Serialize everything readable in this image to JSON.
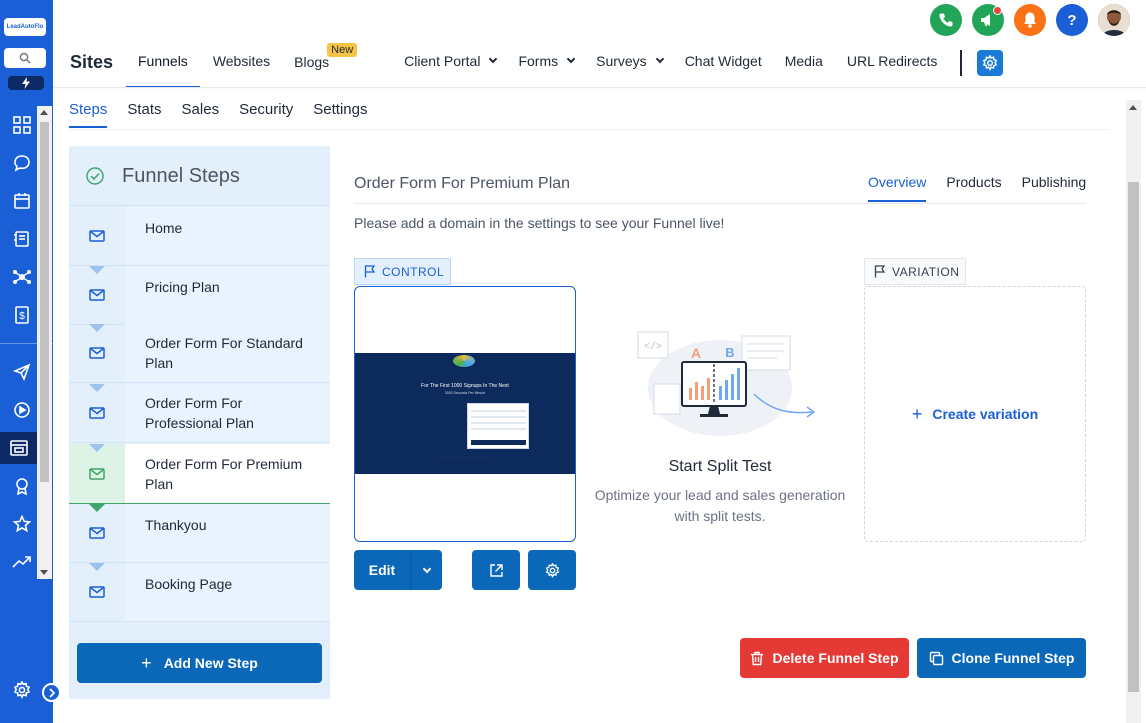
{
  "brand": {
    "logo_text": "LeadAutoFlo"
  },
  "colors": {
    "primary": "#1a5fd6",
    "button": "#0b67b8",
    "danger": "#e53935",
    "success": "#3fa56a",
    "panel": "#e3f0fc"
  },
  "rail": {
    "icons": [
      "dashboard-icon",
      "chat-icon",
      "calendar-icon",
      "contacts-icon",
      "network-icon",
      "payments-icon",
      "send-icon",
      "play-icon",
      "sites-icon",
      "award-icon",
      "star-icon",
      "trending-icon",
      "settings-icon"
    ]
  },
  "top_icons": [
    "phone-icon",
    "megaphone-icon",
    "bell-icon",
    "help-icon",
    "avatar"
  ],
  "header": {
    "title": "Sites",
    "nav": [
      {
        "label": "Funnels",
        "active": true
      },
      {
        "label": "Websites"
      },
      {
        "label": "Blogs",
        "badge": "New"
      },
      {
        "label": "Client Portal",
        "dropdown": true
      },
      {
        "label": "Forms",
        "dropdown": true
      },
      {
        "label": "Surveys",
        "dropdown": true
      },
      {
        "label": "Chat Widget"
      },
      {
        "label": "Media"
      },
      {
        "label": "URL Redirects"
      }
    ]
  },
  "subtabs": [
    {
      "label": "Steps",
      "active": true
    },
    {
      "label": "Stats"
    },
    {
      "label": "Sales"
    },
    {
      "label": "Security"
    },
    {
      "label": "Settings"
    }
  ],
  "steps_panel": {
    "title": "Funnel Steps",
    "steps": [
      {
        "label": "Home"
      },
      {
        "label": "Pricing Plan"
      },
      {
        "label": "Order Form For Standard Plan"
      },
      {
        "label": "Order Form For Professional Plan"
      },
      {
        "label": "Order Form For Premium Plan",
        "active": true
      },
      {
        "label": "Thankyou"
      },
      {
        "label": "Booking Page"
      }
    ],
    "add_button": "Add New Step"
  },
  "content": {
    "title": "Order Form For Premium Plan",
    "tabs": [
      {
        "label": "Overview",
        "active": true
      },
      {
        "label": "Products"
      },
      {
        "label": "Publishing"
      }
    ],
    "domain_message": "Please add a domain in the settings to see your Funnel live!",
    "control_tag": "CONTROL",
    "preview": {
      "headline": "For The First 1000 Signups In The Next",
      "subline": "3000 Seconds Per Minute"
    },
    "edit_button": "Edit",
    "illustration": {
      "a": "A",
      "b": "B"
    },
    "split_title": "Start Split Test",
    "split_desc": "Optimize your lead and sales generation with split tests.",
    "variation_tag": "VARIATION",
    "create_variation": "Create variation",
    "delete_button": "Delete Funnel Step",
    "clone_button": "Clone Funnel Step"
  }
}
